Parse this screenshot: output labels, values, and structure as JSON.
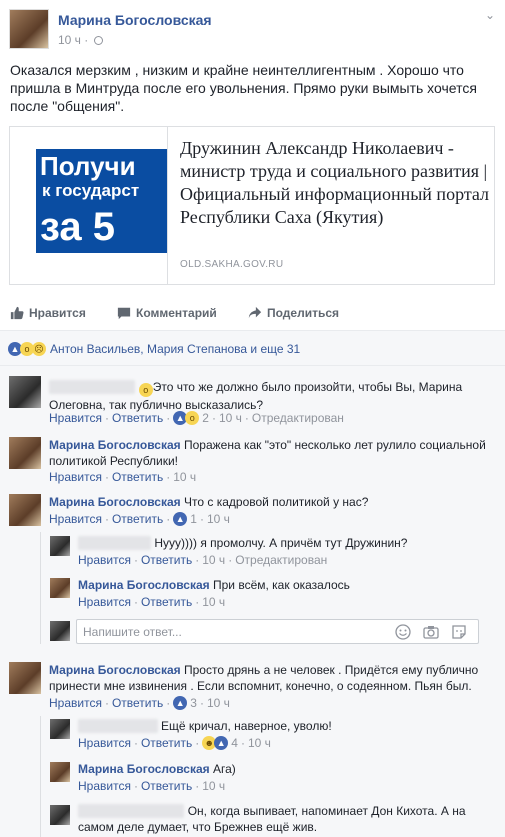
{
  "post": {
    "author": "Марина Богословская",
    "time": "10 ч",
    "text": "Оказался мерзким , низким и крайне неинтеллигентным . Хорошо что пришла в Минтруда после его увольнения. Прямо руки вымыть хочется после \"общения\".",
    "link_card": {
      "image_lines": [
        "Получи",
        "к государст",
        "за 5"
      ],
      "title": "Дружинин Александр Николаевич - министр труда и социального развития | Официальный информационный портал Республики Саха (Якутия)",
      "domain": "OLD.SAKHA.GOV.RU"
    }
  },
  "actions": {
    "like": "Нравится",
    "comment": "Комментарий",
    "share": "Поделиться"
  },
  "reactions_summary": "Антон Васильев, Мария Степанова и еще 31",
  "comments": [
    {
      "author": "",
      "text": "Это что же должно было произойти, чтобы Вы, Марина Олеговна, так публично высказались?",
      "like": "Нравится",
      "reply": "Ответить",
      "count": "2",
      "time": "10 ч",
      "edited": "Отредактирован"
    },
    {
      "author": "Марина Богословская",
      "text": "Поражена как \"это\" несколько лет рулило социальной политикой Республики!",
      "like": "Нравится",
      "reply": "Ответить",
      "time": "10 ч"
    },
    {
      "author": "Марина Богословская",
      "text": "Что с кадровой политикой у нас?",
      "like": "Нравится",
      "reply": "Ответить",
      "count": "1",
      "time": "10 ч",
      "replies": [
        {
          "author": "",
          "text": "Нууу)))) я промолчу. А причём тут Дружинин?",
          "like": "Нравится",
          "reply": "Ответить",
          "time": "10 ч",
          "edited": "Отредактирован"
        },
        {
          "author": "Марина Богословская",
          "text": "При всём, как оказалось",
          "like": "Нравится",
          "reply": "Ответить",
          "time": "10 ч"
        }
      ],
      "reply_placeholder": "Напишите ответ..."
    },
    {
      "author": "Марина Богословская",
      "text": "Просто дрянь а не человек . Придётся ему публично принести мне извинения . Если вспомнит, конечно, о содеянном. Пьян был.",
      "like": "Нравится",
      "reply": "Ответить",
      "count": "3",
      "time": "10 ч",
      "replies": [
        {
          "author": "",
          "text": "Ещё кричал, наверное, уволю!",
          "like": "Нравится",
          "reply": "Ответить",
          "count": "4",
          "time": "10 ч"
        },
        {
          "author": "Марина Богословская",
          "text": "Ага)",
          "like": "Нравится",
          "reply": "Ответить",
          "time": "10 ч"
        },
        {
          "author": "",
          "text": "Он, когда выпивает, напоминает Дон Кихота. А на самом деле думает, что Брежнев ещё жив."
        }
      ]
    }
  ],
  "colors": {
    "link": "#365899",
    "meta": "#90949c",
    "like_blue": "#4267b2",
    "bg_comments": "#f6f7f9"
  }
}
